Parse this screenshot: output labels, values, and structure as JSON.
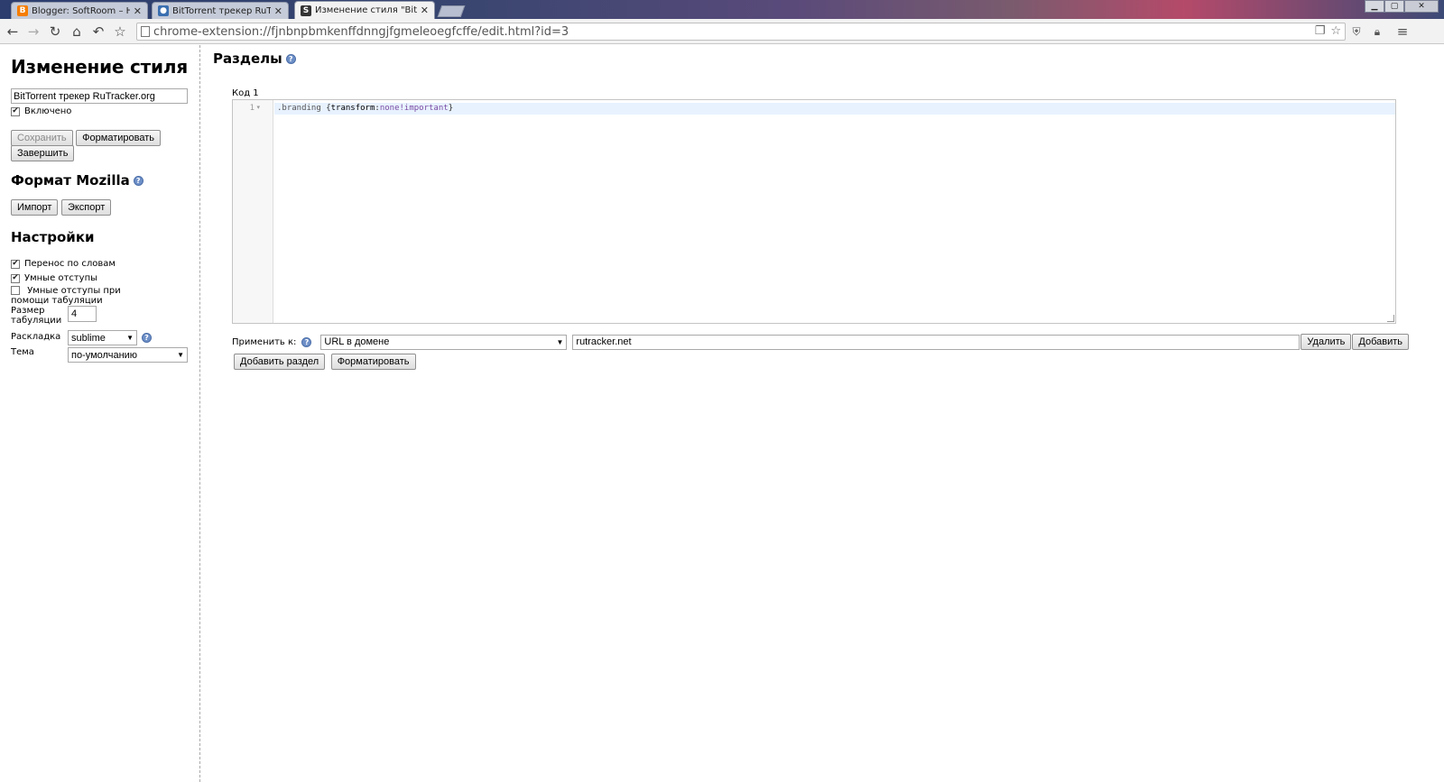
{
  "browser": {
    "tabs": [
      {
        "title": "Blogger: SoftRoom – Нов",
        "icon": "blogger-icon",
        "active": false
      },
      {
        "title": "BitTorrent трекер RuTrack",
        "icon": "rutracker-icon",
        "active": false
      },
      {
        "title": "Изменение стиля \"BitTor",
        "icon": "stylish-icon",
        "active": true
      }
    ],
    "url": "chrome-extension://fjnbnpbmkenffdnngjfgmeleoegfcffe/edit.html?id=3"
  },
  "sidebar": {
    "title": "Изменение стиля",
    "style_name": "BitTorrent трекер RuTracker.org",
    "enabled_label": "Включено",
    "enabled": true,
    "save_label": "Сохранить",
    "format_label": "Форматировать",
    "finish_label": "Завершить",
    "mozilla_title": "Формат Mozilla",
    "import_label": "Импорт",
    "export_label": "Экспорт",
    "settings_title": "Настройки",
    "settings": {
      "word_wrap_label": "Перенос по словам",
      "word_wrap": true,
      "smart_indent_label": "Умные отступы",
      "smart_indent": true,
      "smart_indent_tab_label": "Умные отступы при помощи табуляции",
      "smart_indent_tab": false,
      "tab_size_label": "Размер табуляции",
      "tab_size": "4",
      "keymap_label": "Раскладка",
      "keymap": "sublime",
      "theme_label": "Тема",
      "theme": "по-умолчанию"
    }
  },
  "main": {
    "title": "Разделы",
    "section_label": "Код 1",
    "line_number": "1",
    "code": {
      "selector": ".branding",
      "open": " {",
      "property": "transform",
      "colon": ":",
      "value": "none!important",
      "close": "}"
    },
    "apply_label": "Применить к:",
    "apply_type": "URL в домене",
    "apply_value": "rutracker.net",
    "delete_label": "Удалить",
    "add_label": "Добавить",
    "add_section_label": "Добавить раздел",
    "format_label": "Форматировать"
  }
}
